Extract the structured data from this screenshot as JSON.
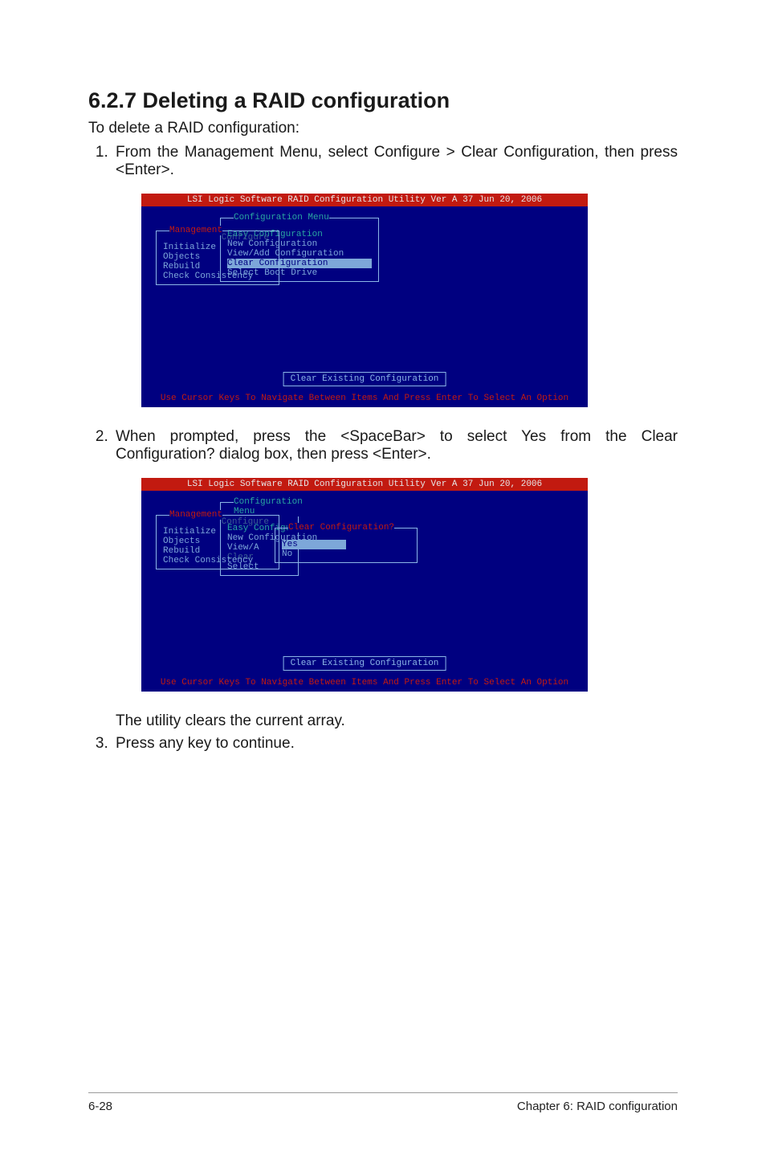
{
  "heading": "6.2.7 Deleting a RAID configuration",
  "lead": "To delete a RAID configuration:",
  "steps": {
    "s1": "From the Management Menu, select Configure > Clear Configuration, then press <Enter>.",
    "s2": "When prompted, press the <SpaceBar> to select Yes from the Clear Configuration? dialog box, then press <Enter>.",
    "s2b": "The utility clears the current array.",
    "s3": "Press any key to continue."
  },
  "bios": {
    "title": "LSI Logic Software RAID Configuration Utility Ver A 37 Jun 20, 2006",
    "mgmt": {
      "title": "Management",
      "items": [
        "Configure",
        "Initialize",
        "Objects",
        "Rebuild",
        "Check Consistency"
      ]
    },
    "cfg": {
      "title": "Configuration Menu",
      "items": [
        "Easy Configuration",
        "New Configuration",
        "View/Add Configuration",
        "Clear Configuration",
        "Select Boot Drive"
      ]
    },
    "cfg_short": {
      "items": [
        "Easy Configuration",
        "New Configuration",
        "View/A",
        "Clear",
        "Select"
      ]
    },
    "dialog": {
      "title": "Clear Configuration?",
      "yes": "Yes",
      "no": "No"
    },
    "status": "Clear Existing Configuration",
    "hint": "Use Cursor Keys To Navigate Between Items And Press Enter To Select An Option"
  },
  "footer": {
    "left": "6-28",
    "right": "Chapter 6: RAID configuration"
  }
}
